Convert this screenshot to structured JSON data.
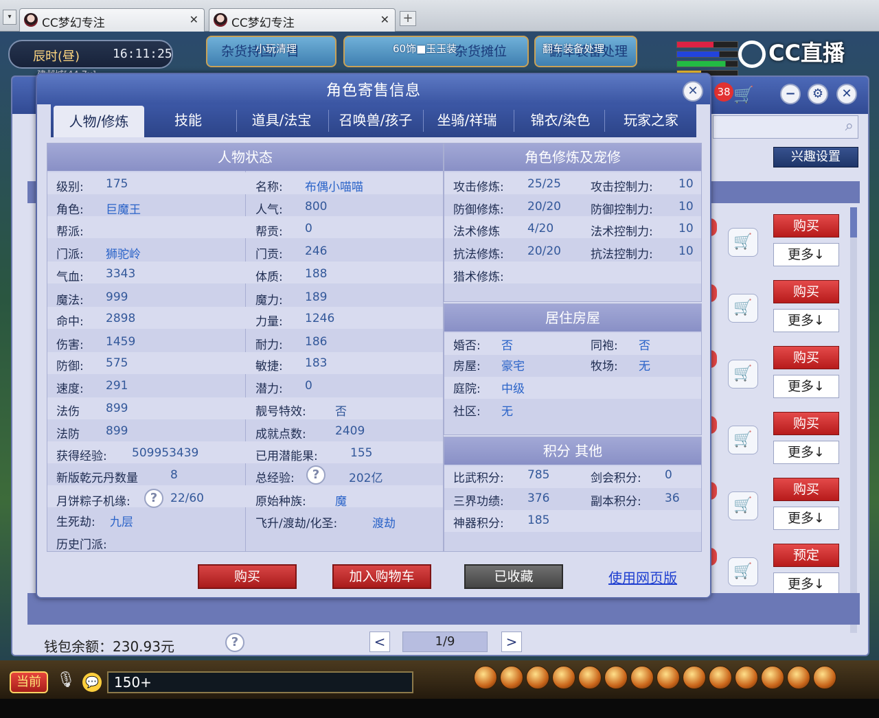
{
  "browser": {
    "tabs": [
      {
        "title": "CC梦幻专注"
      },
      {
        "title": "CC梦幻专注"
      }
    ],
    "newtab_symbol": "+",
    "dropdown_symbol": "▾",
    "close_symbol": "✕"
  },
  "hud": {
    "daytime": "辰时(昼)",
    "clock": "16:11:25",
    "location": "建邺城[44,7x]",
    "banners": [
      {
        "main": "杂货持国广目",
        "sub": "小玩清理"
      },
      {
        "main": "杂货摊位",
        "sub": "60饰■玉玉装"
      },
      {
        "main": "翻车装备处理",
        "sub": "翻车装备处理"
      }
    ],
    "stream_logo": "CC直播"
  },
  "shop": {
    "cart_badge": "38",
    "interest_button": "兴趣设置",
    "rows": [
      {
        "buy": "购买",
        "more": "更多↓"
      },
      {
        "buy": "购买",
        "more": "更多↓"
      },
      {
        "buy": "购买",
        "more": "更多↓"
      },
      {
        "buy": "购买",
        "more": "更多↓"
      },
      {
        "buy": "购买",
        "more": "更多↓"
      },
      {
        "buy": "预定",
        "more": "更多↓"
      }
    ],
    "wallet": "钱包余额：230.93元",
    "pager": {
      "prev": "<",
      "current": "1/9",
      "next": ">"
    },
    "help": "?"
  },
  "modal": {
    "title": "角色寄售信息",
    "close": "✕",
    "tabs": [
      "人物/修炼",
      "技能",
      "道具/法宝",
      "召唤兽/孩子",
      "坐骑/祥瑞",
      "锦衣/染色",
      "玩家之家"
    ],
    "status": {
      "title": "人物状态",
      "left": [
        {
          "label": "级别:",
          "value": "175"
        },
        {
          "label": "角色:",
          "value": "巨魔王"
        },
        {
          "label": "帮派:",
          "value": ""
        },
        {
          "label": "门派:",
          "value": "狮驼岭"
        },
        {
          "label": "气血:",
          "value": "3343"
        },
        {
          "label": "魔法:",
          "value": "999"
        },
        {
          "label": "命中:",
          "value": "2898"
        },
        {
          "label": "伤害:",
          "value": "1459"
        },
        {
          "label": "防御:",
          "value": "575"
        },
        {
          "label": "速度:",
          "value": "291"
        },
        {
          "label": "法伤",
          "value": "899"
        },
        {
          "label": "法防",
          "value": "899"
        },
        {
          "label": "获得经验:",
          "value": "509953439"
        },
        {
          "label": "新版乾元丹数量",
          "value": "8"
        },
        {
          "label": "月饼粽子机缘:",
          "value": "22/60"
        },
        {
          "label": "生死劫:",
          "value": "九层"
        },
        {
          "label": "历史门派:",
          "value": ""
        }
      ],
      "right": [
        {
          "label": "名称:",
          "value": "布偶小喵喵"
        },
        {
          "label": "人气:",
          "value": "800"
        },
        {
          "label": "帮贡:",
          "value": "0"
        },
        {
          "label": "门贡:",
          "value": "246"
        },
        {
          "label": "体质:",
          "value": "188"
        },
        {
          "label": "魔力:",
          "value": "189"
        },
        {
          "label": "力量:",
          "value": "1246"
        },
        {
          "label": "耐力:",
          "value": "186"
        },
        {
          "label": "敏捷:",
          "value": "183"
        },
        {
          "label": "潜力:",
          "value": "0"
        },
        {
          "label": "靓号特效:",
          "value": "否"
        },
        {
          "label": "成就点数:",
          "value": "2409"
        },
        {
          "label": "已用潜能果:",
          "value": "155"
        },
        {
          "label": "总经验:",
          "value": "202亿"
        },
        {
          "label": "原始种族:",
          "value": "魔"
        },
        {
          "label": "飞升/渡劫/化圣:",
          "value": "渡劫"
        }
      ]
    },
    "cultivation": {
      "title": "角色修炼及宠修",
      "rows": [
        {
          "label": "攻击修炼:",
          "value": "25/25",
          "label2": "攻击控制力:",
          "value2": "10"
        },
        {
          "label": "防御修炼:",
          "value": "20/20",
          "label2": "防御控制力:",
          "value2": "10"
        },
        {
          "label": "法术修炼",
          "value": "4/20",
          "label2": "法术控制力:",
          "value2": "10"
        },
        {
          "label": "抗法修炼:",
          "value": "20/20",
          "label2": "抗法控制力:",
          "value2": "10"
        },
        {
          "label": "猎术修炼:",
          "value": "",
          "label2": "",
          "value2": ""
        }
      ]
    },
    "house": {
      "title": "居住房屋",
      "rows": [
        {
          "label": "婚否:",
          "value": "否",
          "label2": "同袍:",
          "value2": "否"
        },
        {
          "label": "房屋:",
          "value": "豪宅",
          "label2": "牧场:",
          "value2": "无"
        },
        {
          "label": "庭院:",
          "value": "中级",
          "label2": "",
          "value2": ""
        },
        {
          "label": "社区:",
          "value": "无",
          "label2": "",
          "value2": ""
        }
      ]
    },
    "points": {
      "title": "积分 其他",
      "rows": [
        {
          "label": "比武积分:",
          "value": "785",
          "label2": "剑会积分:",
          "value2": "0"
        },
        {
          "label": "三界功绩:",
          "value": "376",
          "label2": "副本积分:",
          "value2": "36"
        },
        {
          "label": "神器积分:",
          "value": "185",
          "label2": "",
          "value2": ""
        }
      ]
    },
    "buttons": {
      "buy": "购买",
      "add_cart": "加入购物车",
      "favorited": "已收藏",
      "web": "使用网页版"
    },
    "help": "?"
  },
  "bottom": {
    "channel": "当前",
    "chat_value": "150+"
  }
}
